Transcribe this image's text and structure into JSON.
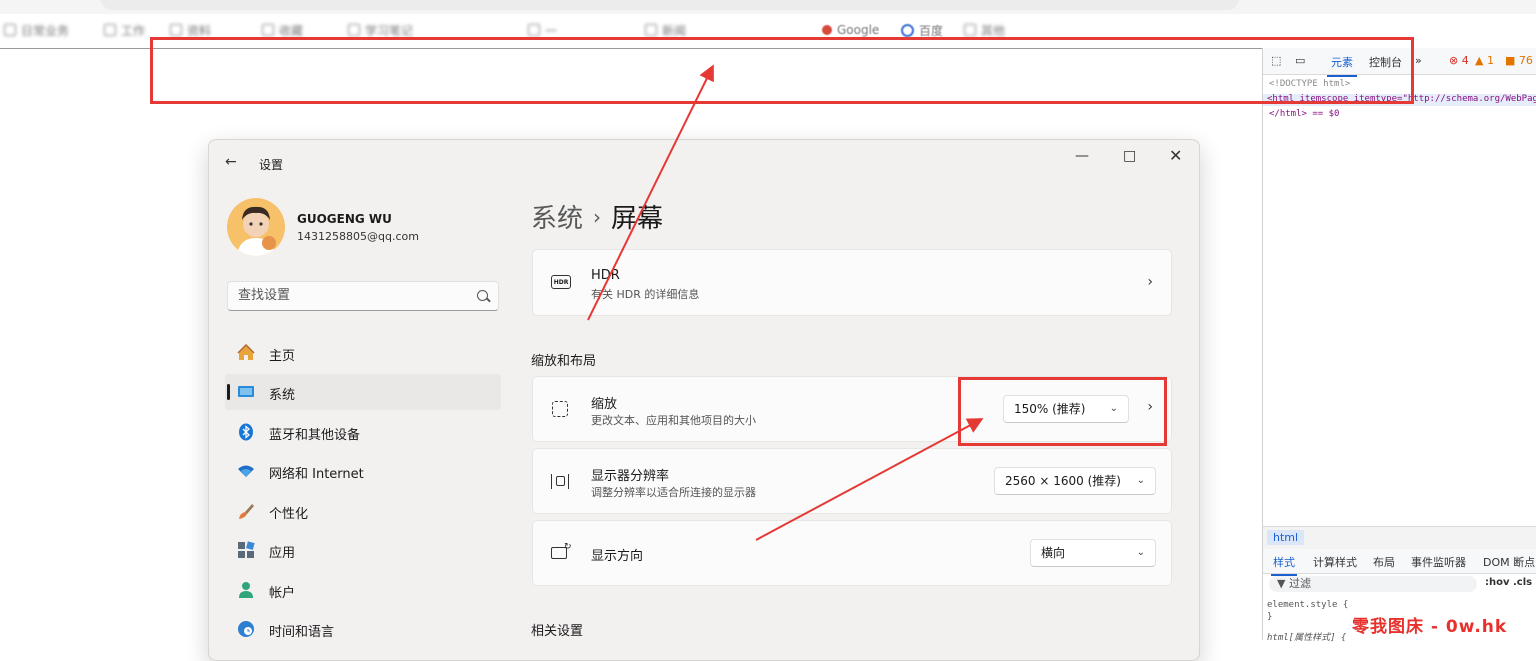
{
  "browser": {
    "bookmarks": [
      {
        "label": "日常业务"
      },
      {
        "label": "工作"
      },
      {
        "label": "资料"
      },
      {
        "label": "收藏"
      },
      {
        "label": "学习笔记"
      },
      {
        "label": "一"
      },
      {
        "label": "新闻"
      },
      {
        "label": "Google"
      },
      {
        "label": "百度"
      },
      {
        "label": "其他"
      }
    ]
  },
  "devtools": {
    "tab_elements": "元素",
    "tab_console": "控制台",
    "more": "»",
    "errors": "4",
    "warnings": "1",
    "info": "76",
    "lines": [
      "<!DOCTYPE html>",
      "<html itemscope itemtype=\"http://schema.org/WebPage\"",
      "</html> == $0"
    ],
    "breadcrumb": "html",
    "subtabs": [
      "样式",
      "计算样式",
      "布局",
      "事件监听器",
      "DOM 断点"
    ],
    "filter": "过滤",
    "hov": ":hov  .cls",
    "css_lines": [
      "element.style {",
      "}",
      "html[属性样式] {"
    ]
  },
  "settings": {
    "window_title": "设置",
    "user_name": "GUOGENG WU",
    "user_email": "1431258805@qq.com",
    "search_placeholder": "查找设置",
    "nav": [
      {
        "label": "主页",
        "icon": "home-icon"
      },
      {
        "label": "系统",
        "icon": "system-icon"
      },
      {
        "label": "蓝牙和其他设备",
        "icon": "bluetooth-icon"
      },
      {
        "label": "网络和 Internet",
        "icon": "wifi-icon"
      },
      {
        "label": "个性化",
        "icon": "brush-icon"
      },
      {
        "label": "应用",
        "icon": "apps-icon"
      },
      {
        "label": "帐户",
        "icon": "account-icon"
      },
      {
        "label": "时间和语言",
        "icon": "globe-icon"
      }
    ],
    "breadcrumb_parent": "系统",
    "breadcrumb_sep": "›",
    "breadcrumb_current": "屏幕",
    "hdr": {
      "title": "HDR",
      "subtitle": "有关 HDR 的详细信息",
      "icon_text": "HDR"
    },
    "section_scale": "缩放和布局",
    "scale": {
      "title": "缩放",
      "subtitle": "更改文本、应用和其他项目的大小",
      "value": "150% (推荐)"
    },
    "resolution": {
      "title": "显示器分辨率",
      "subtitle": "调整分辨率以适合所连接的显示器",
      "value": "2560 × 1600 (推荐)"
    },
    "orientation": {
      "title": "显示方向",
      "value": "横向"
    },
    "section_related": "相关设置"
  },
  "watermark": "零我图床 - 0w.hk",
  "colors": {
    "annotation_red": "#e53935",
    "accent_blue": "#0067c0",
    "devtools_blue": "#1a5fd0"
  }
}
